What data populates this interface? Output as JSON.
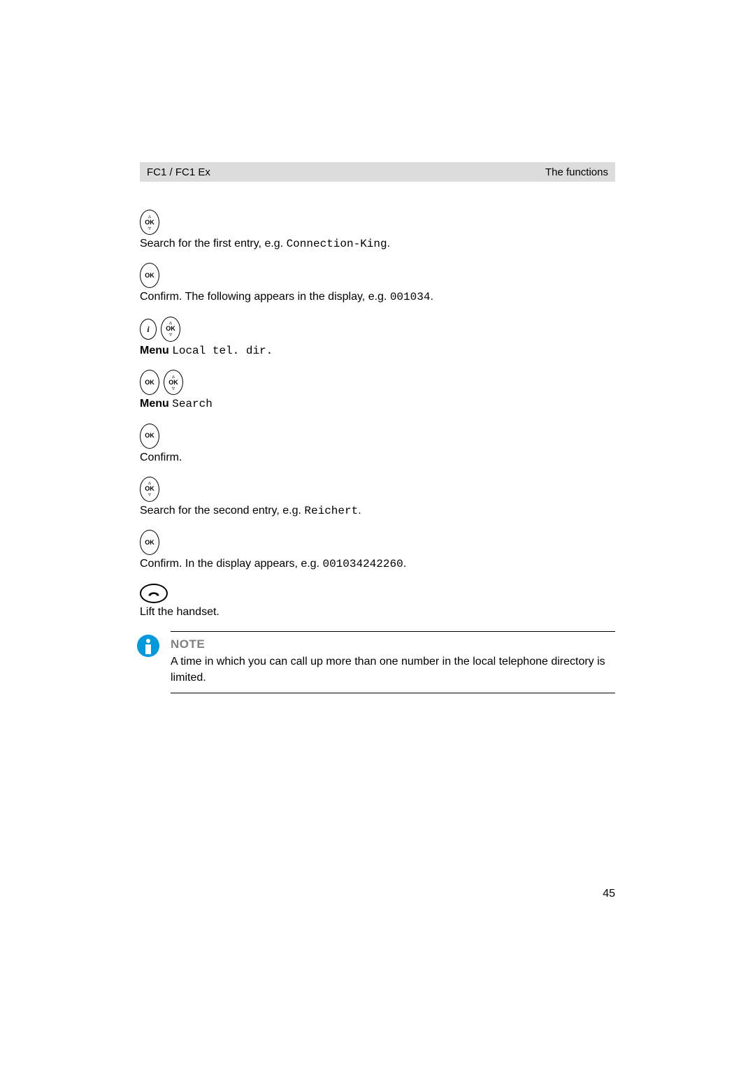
{
  "header": {
    "left": "FC1 / FC1 Ex",
    "right": "The functions"
  },
  "steps": [
    {
      "icons": [
        "ok-nav"
      ],
      "text_parts": [
        {
          "text": "Search for the first entry, e.g. ",
          "mono": false
        },
        {
          "text": "Connection-King",
          "mono": true
        },
        {
          "text": ".",
          "mono": false
        }
      ]
    },
    {
      "icons": [
        "ok"
      ],
      "text_parts": [
        {
          "text": "Confirm. The following appears in the display, e.g. ",
          "mono": false
        },
        {
          "text": "001034",
          "mono": true
        },
        {
          "text": ".",
          "mono": false
        }
      ]
    },
    {
      "icons": [
        "info",
        "ok-nav"
      ],
      "text_parts": [
        {
          "text": "Menu",
          "mono": false,
          "bold": true
        },
        {
          "text": " ",
          "mono": false
        },
        {
          "text": "Local tel. dir.",
          "mono": true
        }
      ]
    },
    {
      "icons": [
        "ok",
        "ok-nav"
      ],
      "text_parts": [
        {
          "text": "Menu",
          "mono": false,
          "bold": true
        },
        {
          "text": " ",
          "mono": false
        },
        {
          "text": "Search",
          "mono": true
        }
      ]
    },
    {
      "icons": [
        "ok"
      ],
      "text_parts": [
        {
          "text": "Confirm.",
          "mono": false
        }
      ]
    },
    {
      "icons": [
        "ok-nav"
      ],
      "text_parts": [
        {
          "text": "Search for the second entry, e.g. ",
          "mono": false
        },
        {
          "text": "Reichert",
          "mono": true
        },
        {
          "text": ".",
          "mono": false
        }
      ]
    },
    {
      "icons": [
        "ok"
      ],
      "text_parts": [
        {
          "text": "Confirm. In the display appears, e.g. ",
          "mono": false
        },
        {
          "text": "001034242260",
          "mono": true
        },
        {
          "text": ".",
          "mono": false
        }
      ]
    },
    {
      "icons": [
        "phone"
      ],
      "text_parts": [
        {
          "text": "Lift the handset.",
          "mono": false
        }
      ]
    }
  ],
  "note": {
    "title": "NOTE",
    "text": "A time in which you can call up more than one number in the local telephone directory is limited."
  },
  "page_number": "45"
}
